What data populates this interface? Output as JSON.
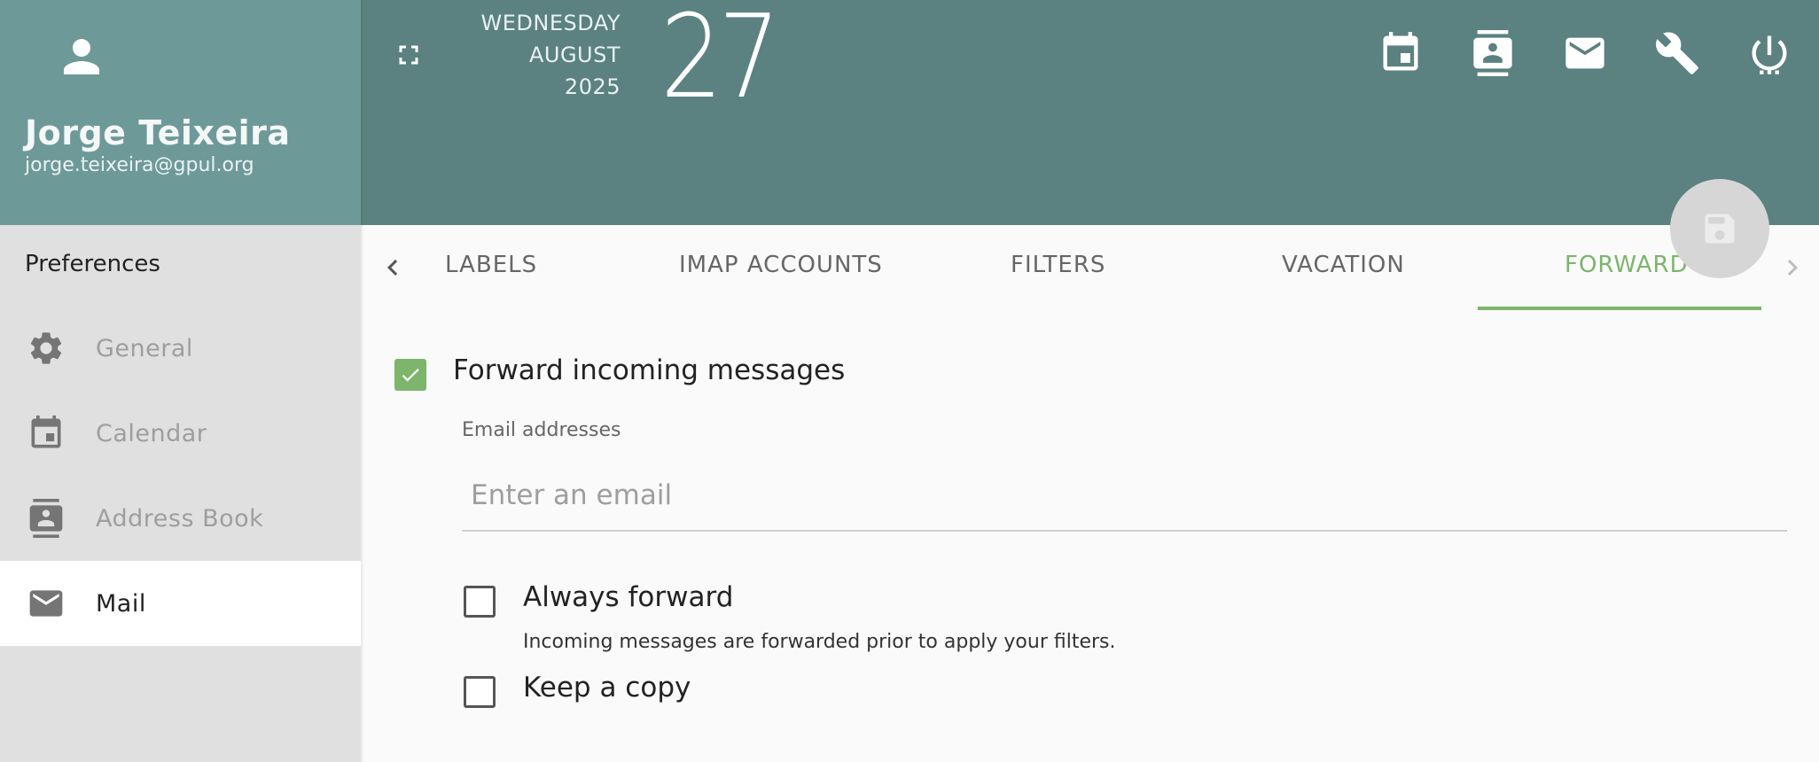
{
  "user": {
    "name": "Jorge Teixeira",
    "email": "jorge.teixeira@gpul.org"
  },
  "sidebar": {
    "title": "Preferences",
    "items": [
      {
        "label": "General",
        "icon": "gear-icon"
      },
      {
        "label": "Calendar",
        "icon": "calendar-icon"
      },
      {
        "label": "Address Book",
        "icon": "contacts-icon"
      },
      {
        "label": "Mail",
        "icon": "mail-icon",
        "active": true
      }
    ]
  },
  "header": {
    "weekday": "WEDNESDAY",
    "month": "AUGUST",
    "year": "2025",
    "day": "27",
    "buttons": [
      "calendar-icon",
      "contacts-icon",
      "mail-icon",
      "wrench-icon",
      "power-icon"
    ]
  },
  "tabs": {
    "items": [
      "LABELS",
      "IMAP ACCOUNTS",
      "FILTERS",
      "VACATION",
      "FORWARD"
    ],
    "active": "FORWARD"
  },
  "forward": {
    "enable_label": "Forward incoming messages",
    "enable_checked": true,
    "addresses_label": "Email addresses",
    "addresses_placeholder": "Enter an email",
    "always_label": "Always forward",
    "always_checked": false,
    "always_hint": "Incoming messages are forwarded prior to apply your filters.",
    "copy_label": "Keep a copy",
    "copy_checked": false
  },
  "colors": {
    "accent": "#7cb56b",
    "header": "#5b8181",
    "profile": "#6e9999"
  }
}
